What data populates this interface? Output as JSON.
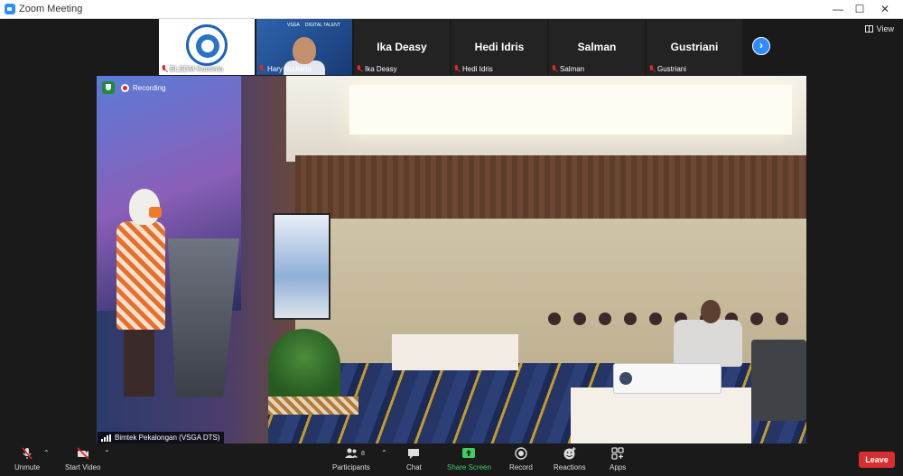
{
  "window": {
    "title": "Zoom Meeting",
    "controls": {
      "minimize": "—",
      "maximize": "☐",
      "close": "✕"
    }
  },
  "view_button": {
    "label": "View"
  },
  "participants_strip": [
    {
      "name": "BLSDM Kominfo",
      "type": "logo",
      "muted": true
    },
    {
      "name": "Hary Budiarto",
      "type": "video",
      "muted": true,
      "banner_left": "VSGA",
      "banner_right": "DIGITAL TALENT"
    },
    {
      "name": "Ika Deasy",
      "display": "Ika Deasy",
      "type": "name",
      "muted": true
    },
    {
      "name": "Hedi Idris",
      "display": "Hedi Idris",
      "type": "name",
      "muted": true
    },
    {
      "name": "Salman",
      "display": "Salman",
      "type": "name",
      "muted": true
    },
    {
      "name": "Gustriani",
      "display": "Gustriani",
      "type": "name",
      "muted": true
    }
  ],
  "main_video": {
    "speaker_label": "Bimtek Pekalongan (VSGA DTS)",
    "recording_label": "Recording"
  },
  "toolbar": {
    "unmute": "Unmute",
    "start_video": "Start Video",
    "participants": "Participants",
    "participants_count": "8",
    "chat": "Chat",
    "share_screen": "Share Screen",
    "record": "Record",
    "reactions": "Reactions",
    "apps": "Apps",
    "leave": "Leave"
  },
  "colors": {
    "accent": "#2d8cff",
    "share_green": "#3fcf5e",
    "leave_red": "#d72f2f",
    "muted_red": "#e02828"
  }
}
